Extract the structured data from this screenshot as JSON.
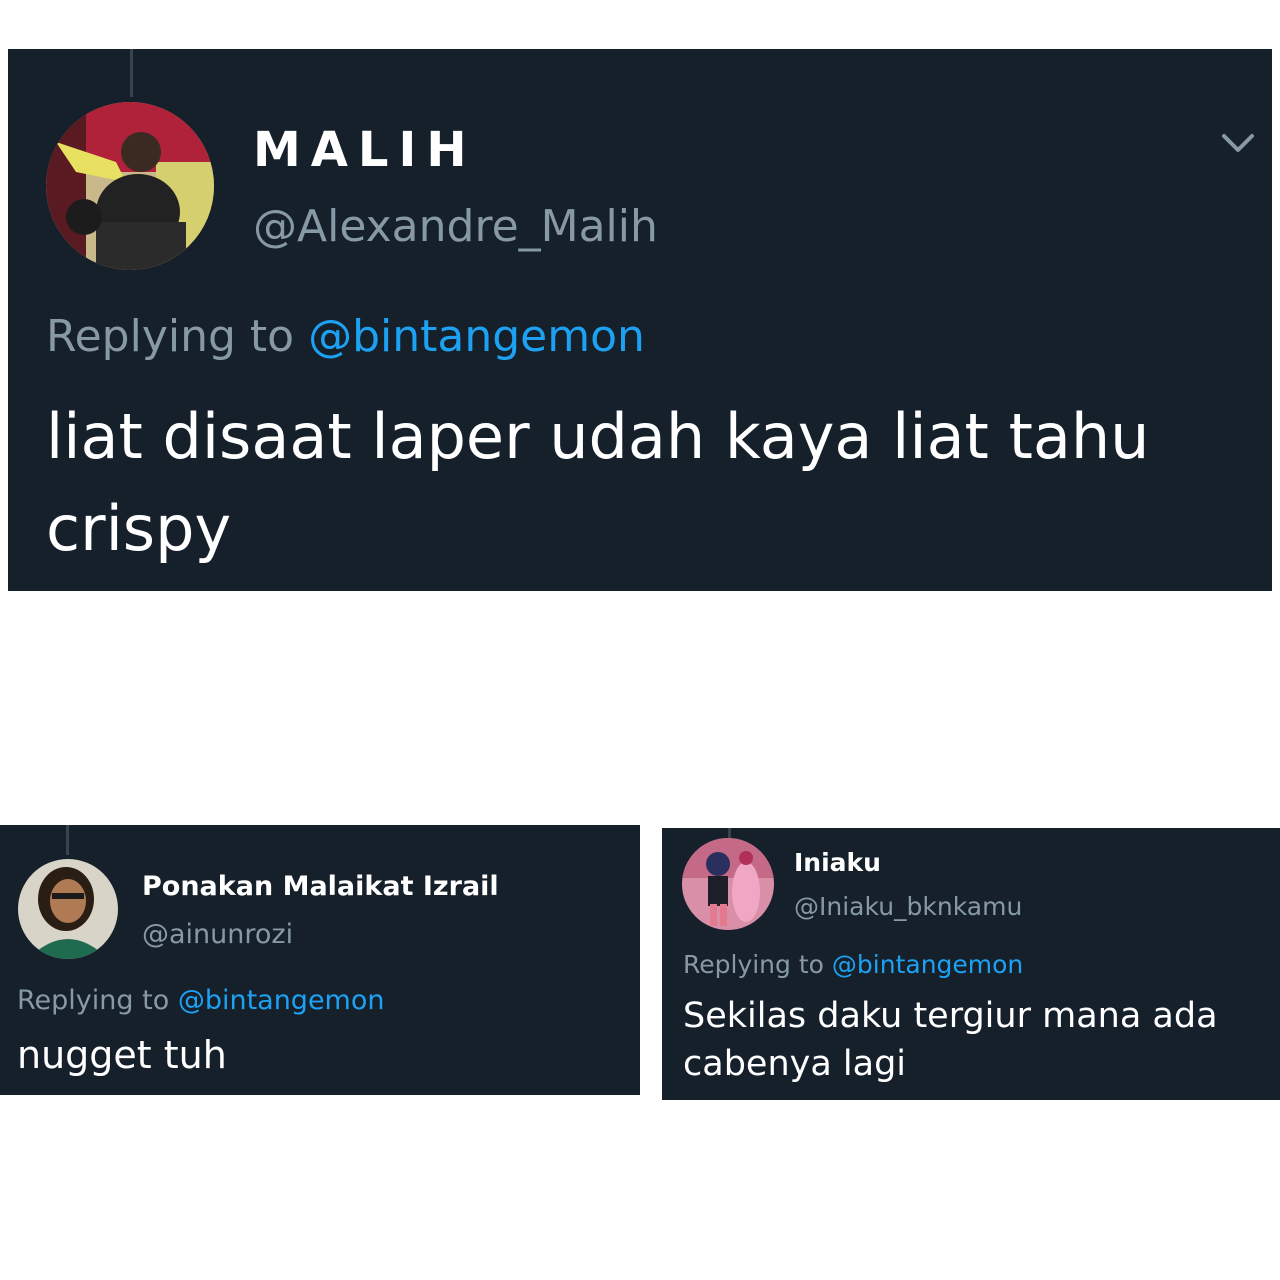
{
  "tweets": [
    {
      "display_name": "MALIH",
      "handle": "@Alexandre_Malih",
      "replying_prefix": "Replying to",
      "replying_to": "@bintangemon",
      "text": "liat disaat laper udah kaya liat tahu crispy",
      "menu_icon": "chevron-down-icon"
    },
    {
      "display_name": "Ponakan Malaikat Izrail",
      "handle": "@ainunrozi",
      "replying_prefix": "Replying to",
      "replying_to": "@bintangemon",
      "text": "nugget tuh"
    },
    {
      "display_name": "Iniaku",
      "handle": "@Iniaku_bknkamu",
      "replying_prefix": "Replying to",
      "replying_to": "@bintangemon",
      "text": "Sekilas daku tergiur mana ada cabenya lagi"
    }
  ],
  "colors": {
    "card_background": "#15202b",
    "secondary_text": "#8899a6",
    "mention_blue": "#1da1f2",
    "primary_text": "#ffffff"
  }
}
